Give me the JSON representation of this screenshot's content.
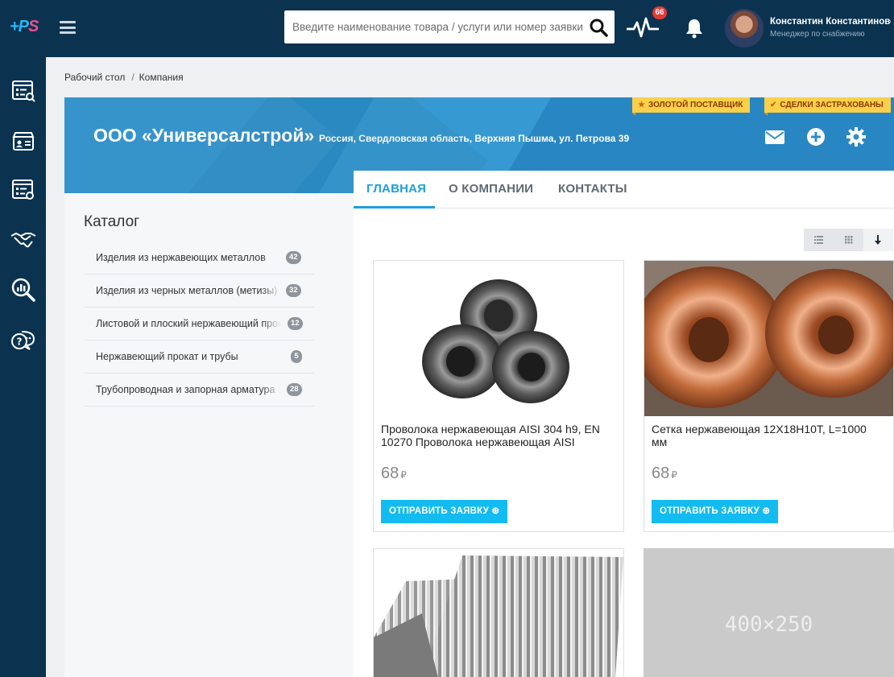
{
  "app": {
    "logo_prefix": "+P",
    "logo_suffix": "S"
  },
  "header": {
    "search_placeholder": "Введите наименование товара / услуги или номер заявки",
    "notifications_badge": "66",
    "user_name": "Константин Константиновский",
    "user_role": "Менеджер по снабжению"
  },
  "sidebar": {
    "items": [
      "requests-list-icon",
      "supplier-card-icon",
      "orders-list-icon",
      "deals-handshake-icon",
      "analytics-search-icon",
      "support-chat-icon"
    ]
  },
  "breadcrumb": {
    "home": "Рабочий стол",
    "separator": "/",
    "current": "Компания"
  },
  "company": {
    "name": "ООО «Универсалстрой»",
    "address": "Россия, Свердловская область, Верхняя Пышма, ул. Петрова 39",
    "badge_gold": "ЗОЛОТОЙ ПОСТАВЩИК",
    "badge_insured": "СДЕЛКИ ЗАСТРАХОВАНЫ"
  },
  "catalog": {
    "title": "Каталог",
    "items": [
      {
        "label": "Изделия из нержавеющих металлов",
        "count": "42"
      },
      {
        "label": "Изделия из черных металлов (метизы)",
        "count": "32"
      },
      {
        "label": "Листовой и плоский нержавеющий прокат",
        "count": "12"
      },
      {
        "label": "Нержавеющий прокат и трубы",
        "count": "5"
      },
      {
        "label": "Трубопроводная и запорная арматура",
        "count": "28"
      }
    ]
  },
  "tabs": {
    "main": "ГЛАВНАЯ",
    "about": "О КОМПАНИИ",
    "contacts": "КОНТАКТЫ"
  },
  "products": [
    {
      "title": "Проволока нержавеющая AISI 304 h9, EN 10270 Проволока нержавеющая AISI",
      "price": "68",
      "currency": "₽",
      "button": "ОТПРАВИТЬ ЗАЯВКУ"
    },
    {
      "title": "Сетка нержавеющая 12Х18Н10Т, L=1000 мм",
      "price": "68",
      "currency": "₽",
      "button": "ОТПРАВИТЬ ЗАЯВКУ"
    },
    {
      "title": "",
      "price": "",
      "currency": "",
      "button": ""
    },
    {
      "title": "",
      "price": "",
      "currency": "",
      "button": "",
      "image_placeholder": "400×250"
    }
  ],
  "colors": {
    "topbar": "#0b3350",
    "accent": "#1e9fdd",
    "button": "#12bbf0",
    "badge": "#fbd04a"
  }
}
